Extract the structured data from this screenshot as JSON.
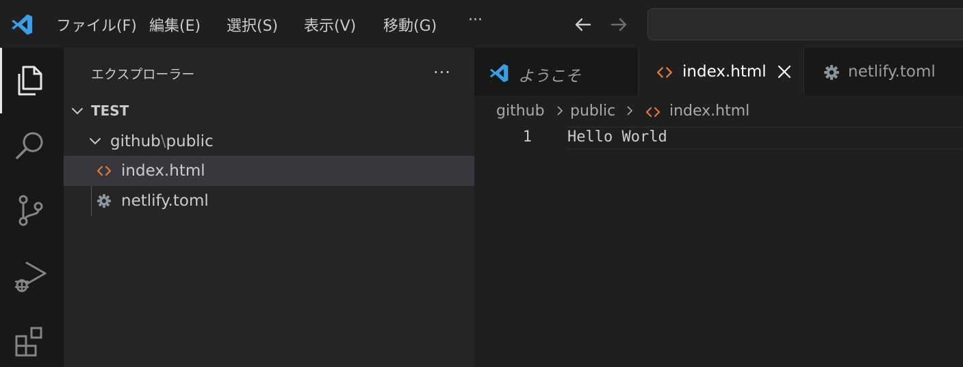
{
  "titlebar": {
    "menu": [
      {
        "label": "ファイル(F)"
      },
      {
        "label": "編集(E)"
      },
      {
        "label": "選択(S)"
      },
      {
        "label": "表示(V)"
      },
      {
        "label": "移動(G)"
      },
      {
        "label": "···"
      }
    ],
    "logo_color": "#3b9de2"
  },
  "activity_bar": {
    "icons": [
      "explorer-icon",
      "search-icon",
      "source-control-icon",
      "run-debug-icon",
      "extensions-icon"
    ],
    "active": "explorer-icon"
  },
  "sidebar": {
    "title": "エクスプローラー",
    "more": "···",
    "section": {
      "label": "TEST",
      "expanded": true
    },
    "folder": {
      "name_a": "github",
      "sep": "\\",
      "name_b": "public",
      "expanded": true
    },
    "files": [
      {
        "name": "index.html",
        "icon": "html-code-icon",
        "selected": true
      },
      {
        "name": "netlify.toml",
        "icon": "gear-icon",
        "selected": false
      }
    ]
  },
  "editor": {
    "tabs": [
      {
        "label": "ようこそ",
        "icon": "vscode-logo-icon",
        "active": false
      },
      {
        "label": "index.html",
        "icon": "html-code-icon",
        "active": true
      },
      {
        "label": "netlify.toml",
        "icon": "gear-icon",
        "active": false
      }
    ],
    "breadcrumb": [
      "github",
      "public",
      "index.html"
    ],
    "lines": [
      {
        "number": "1",
        "text": "Hello World"
      }
    ]
  },
  "colors": {
    "html_icon": "#e37933",
    "gear_icon": "#8b949e",
    "accent": "#3b9de2"
  }
}
